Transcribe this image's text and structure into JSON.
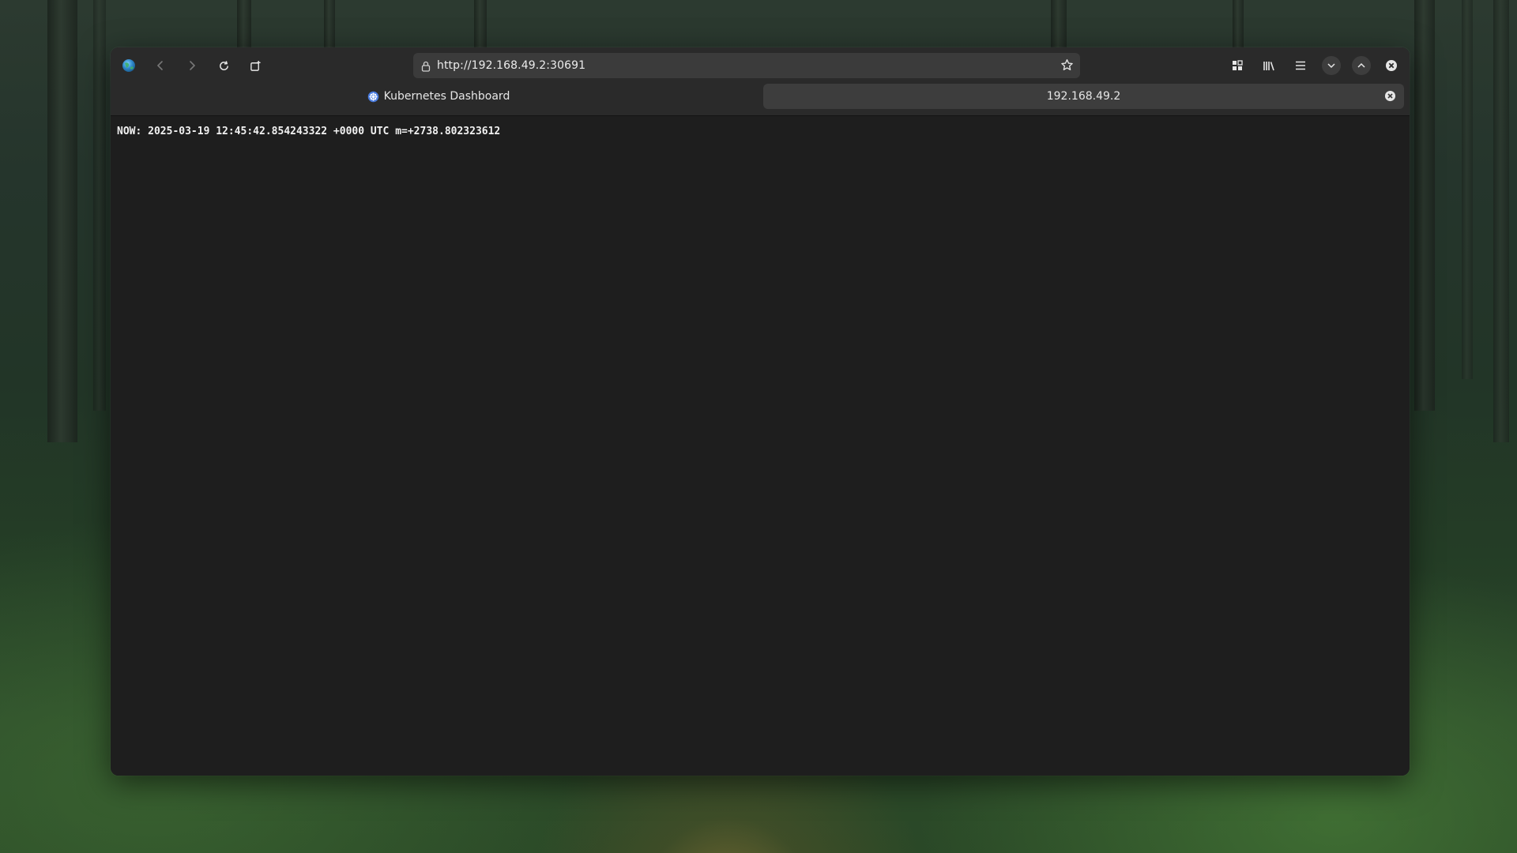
{
  "browser": {
    "url": "http://192.168.49.2:30691",
    "nav_icons": {
      "app": "globe-icon",
      "back": "chevron-left-icon",
      "forward": "chevron-right-icon",
      "reload": "reload-icon",
      "new_tab": "new-tab-icon",
      "lock": "lock-icon",
      "bookmark": "star-icon",
      "extensions": "extensions-icon",
      "library": "library-icon",
      "menu": "hamburger-menu-icon",
      "minimize": "chevron-down-icon",
      "maximize": "chevron-up-icon",
      "close": "close-icon"
    },
    "tabs": [
      {
        "label": "Kubernetes Dashboard",
        "active": false,
        "favicon": "kubernetes-icon"
      },
      {
        "label": "192.168.49.2",
        "active": true
      }
    ]
  },
  "page": {
    "text": "NOW: 2025-03-19 12:45:42.854243322 +0000 UTC m=+2738.802323612"
  },
  "colors": {
    "window_bg": "#1d1d1d",
    "toolbar_bg": "#2a2a2a",
    "urlbar_bg": "#3b3b3b",
    "active_tab_bg": "#3d3d3d",
    "text": "#ececec"
  }
}
